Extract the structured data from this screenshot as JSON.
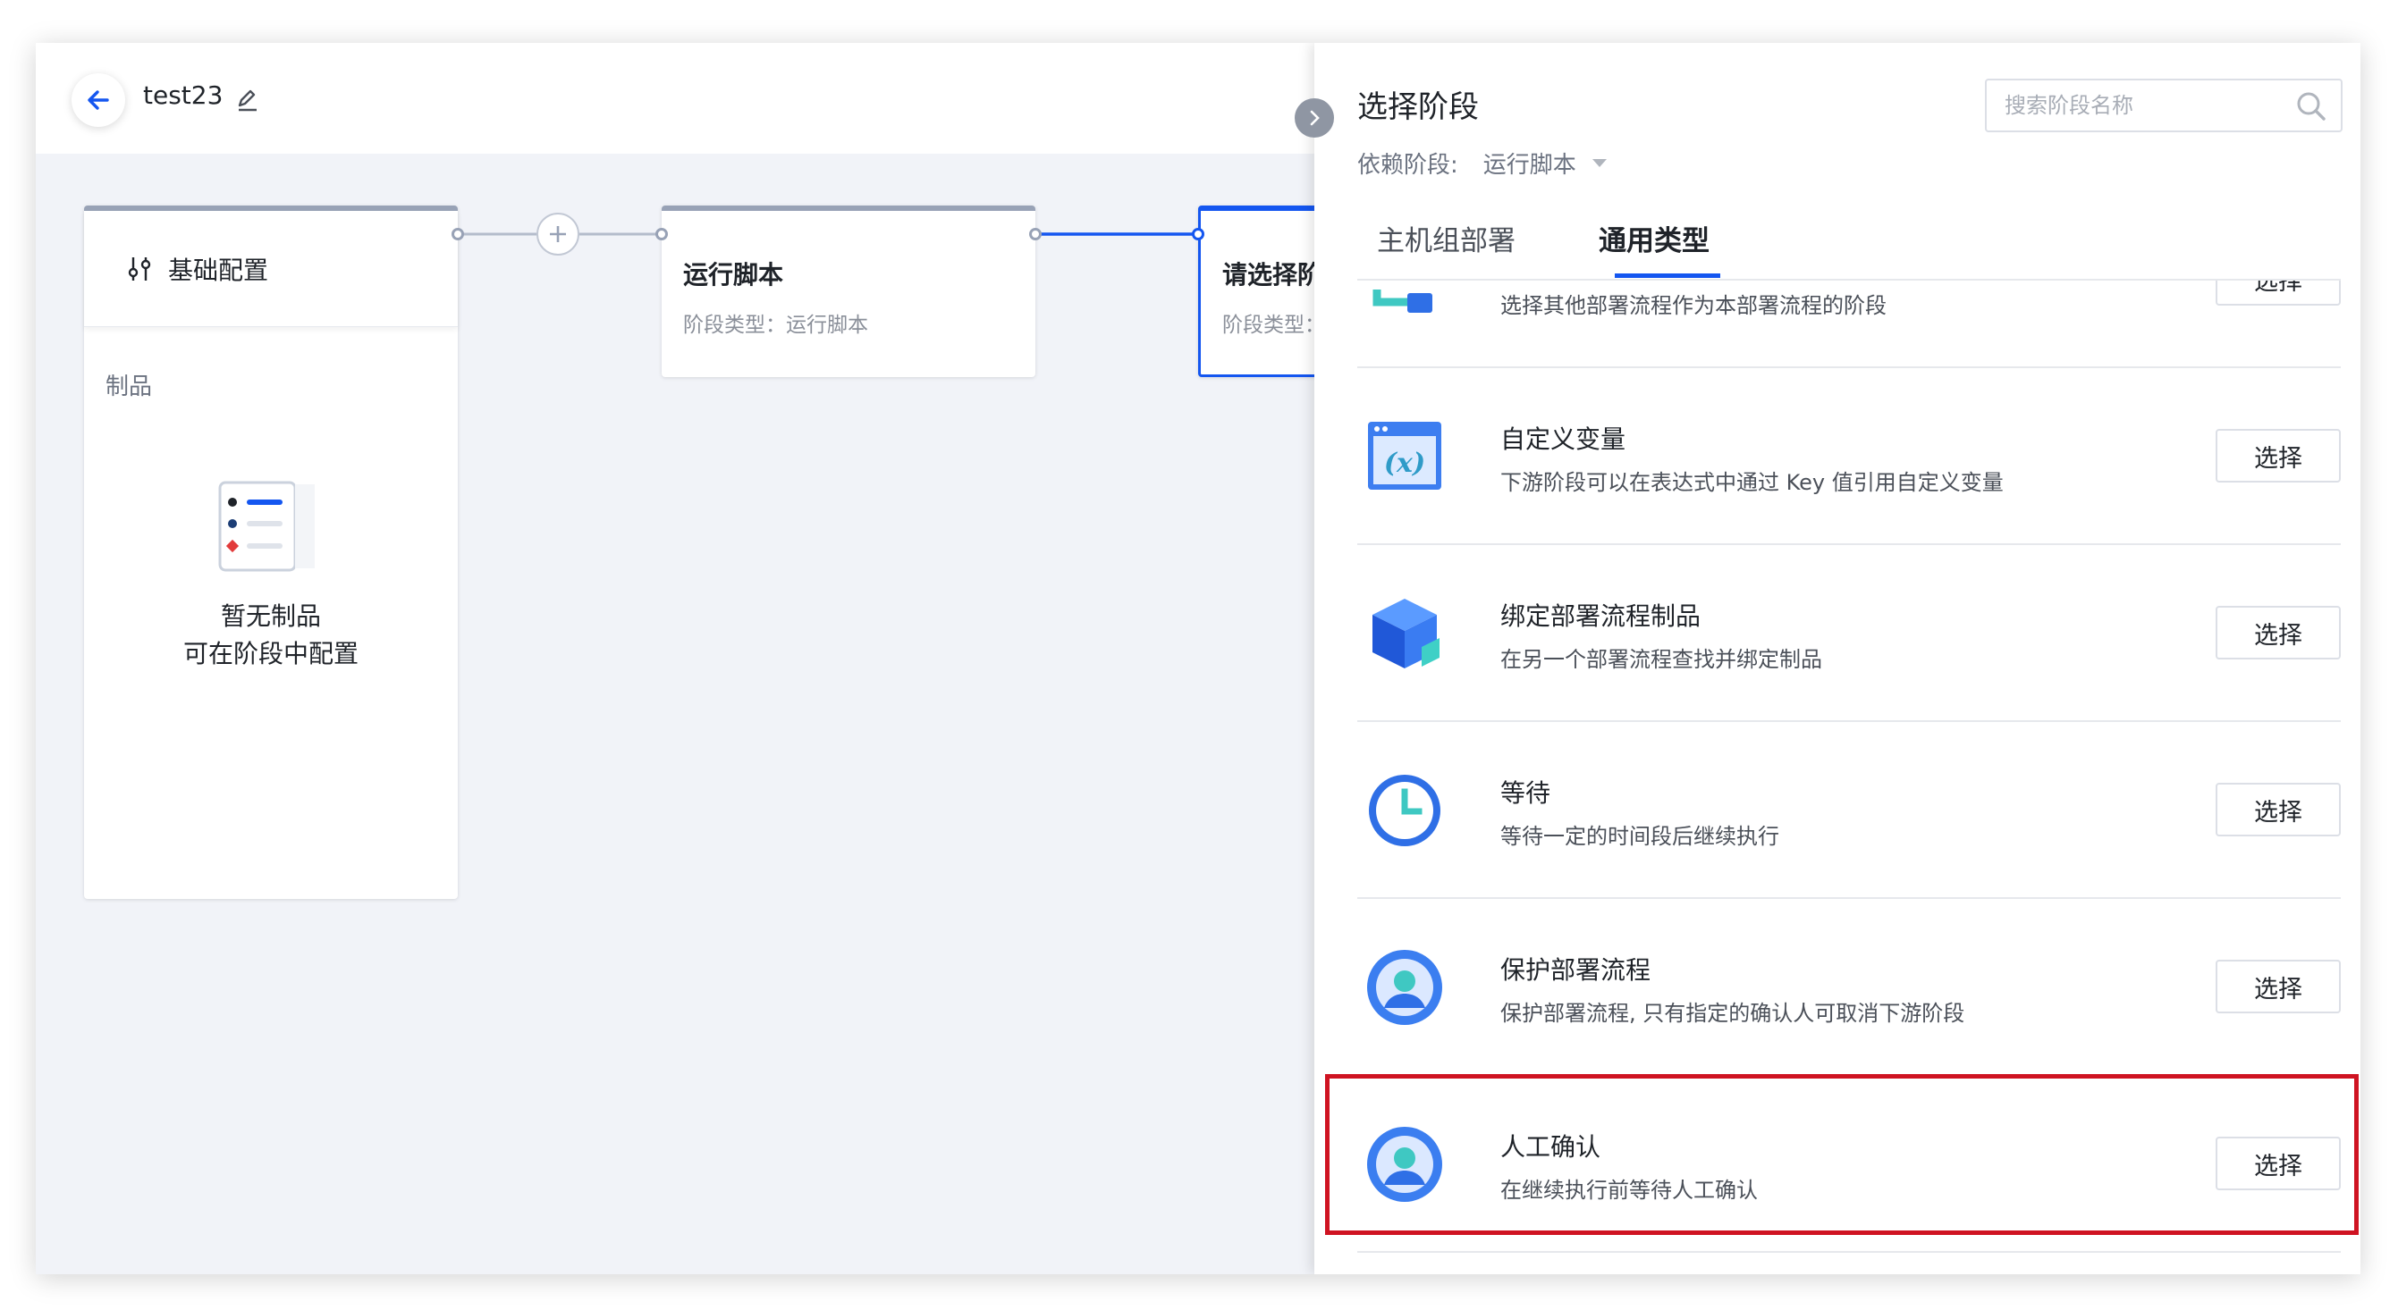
{
  "header": {
    "title": "test23"
  },
  "pipeline": {
    "base_config": {
      "title": "基础配置",
      "artifacts_label": "制品",
      "empty_line1": "暂无制品",
      "empty_line2": "可在阶段中配置"
    },
    "stages": [
      {
        "title": "运行脚本",
        "subtitle": "阶段类型：运行脚本"
      },
      {
        "title": "请选择阶段",
        "subtitle": "阶段类型："
      }
    ]
  },
  "panel": {
    "title": "选择阶段",
    "search_placeholder": "搜索阶段名称",
    "dependency_label": "依赖阶段:",
    "dependency_value": "运行脚本",
    "tabs": [
      {
        "label": "主机组部署",
        "active": false
      },
      {
        "label": "通用类型",
        "active": true
      }
    ],
    "select_label": "选择",
    "items": [
      {
        "title": "",
        "desc": "选择其他部署流程作为本部署流程的阶段",
        "icon": "pipeline-icon"
      },
      {
        "title": "自定义变量",
        "desc": "下游阶段可以在表达式中通过 Key 值引用自定义变量",
        "icon": "variable-icon"
      },
      {
        "title": "绑定部署流程制品",
        "desc": "在另一个部署流程查找并绑定制品",
        "icon": "cube-icon"
      },
      {
        "title": "等待",
        "desc": "等待一定的时间段后继续执行",
        "icon": "clock-icon"
      },
      {
        "title": "保护部署流程",
        "desc": "保护部署流程, 只有指定的确认人可取消下游阶段",
        "icon": "user-icon"
      },
      {
        "title": "人工确认",
        "desc": "在继续执行前等待人工确认",
        "icon": "user-icon",
        "highlighted": true
      }
    ]
  },
  "colors": {
    "accent": "#1456f0",
    "highlight": "#cf1322"
  }
}
